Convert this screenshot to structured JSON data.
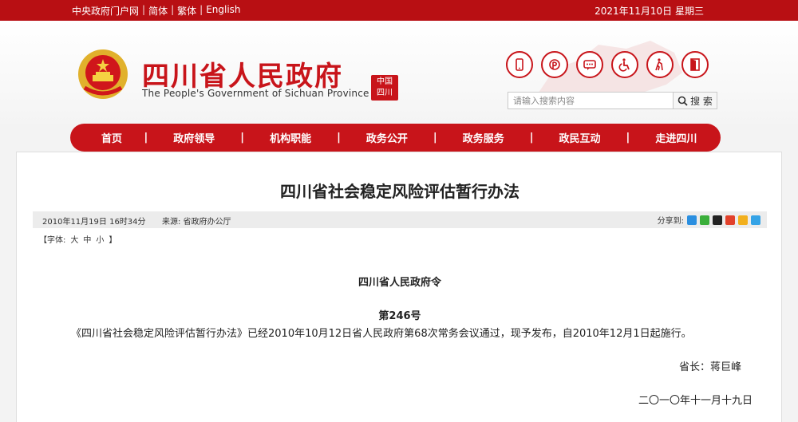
{
  "topbar": {
    "links": [
      "中央政府门户网",
      "简体",
      "繁体",
      "English"
    ],
    "date": "2021年11月10日 星期三"
  },
  "header": {
    "title": "四川省人民政府",
    "subtitle": "The People's Government of Sichuan Province",
    "seal_text": "中国四川",
    "icons": [
      "mobile-icon",
      "weibo-icon",
      "message-icon",
      "accessibility-icon",
      "elderly-icon",
      "exit-icon"
    ],
    "search": {
      "placeholder": "请输入搜索内容",
      "button": "搜 索"
    }
  },
  "nav": {
    "items": [
      "首页",
      "政府领导",
      "机构职能",
      "政务公开",
      "政务服务",
      "政民互动",
      "走进四川"
    ]
  },
  "article": {
    "title": "四川省社会稳定风险评估暂行办法",
    "time": "2010年11月19日 16时34分",
    "source": "来源: 省政府办公厅",
    "share_label": "分享到:",
    "fontsize": {
      "label": "【字体:",
      "large": "大",
      "medium": "中",
      "small": "小",
      "close": "】"
    },
    "decree": "四川省人民政府令",
    "number": "第246号",
    "body": "《四川省社会稳定风险评估暂行办法》已经2010年10月12日省人民政府第68次常务会议通过，现予发布，自2010年12月1日起施行。",
    "signature": "省长：蒋巨峰",
    "date": "二〇一〇年十一月十九日"
  },
  "colors": {
    "brand_red": "#c8141a",
    "topbar_red": "#b80f13"
  }
}
